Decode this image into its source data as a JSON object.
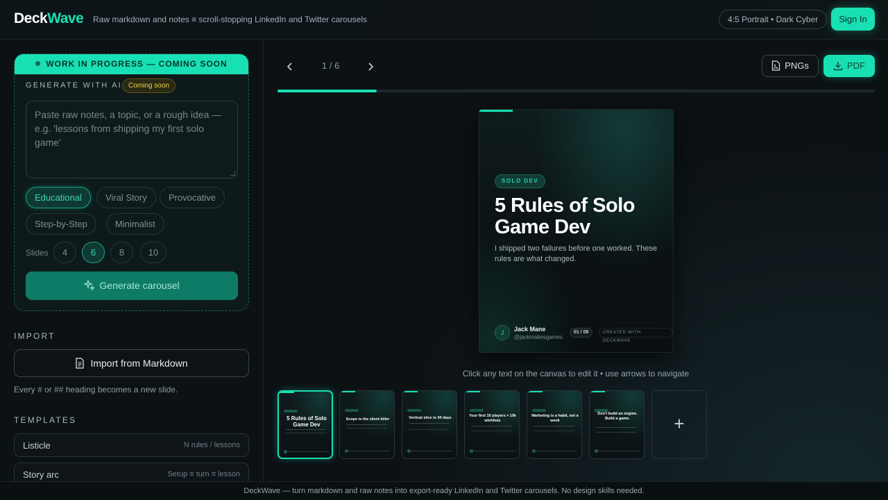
{
  "header": {
    "logo_prefix": "Deck",
    "logo_suffix": "Wave",
    "tagline": "Raw markdown and notes ≡ scroll-stopping LinkedIn and Twitter carousels",
    "format_label": "4:5 Portrait • Dark Cyber",
    "signin_label": "Sign In"
  },
  "sidebar": {
    "wip_banner": "WORK IN PROGRESS — COMING SOON",
    "generate_label": "GENERATE WITH AI",
    "coming_soon_badge": "Coming soon",
    "notes_placeholder": "Paste raw notes, a topic, or a rough idea — e.g. 'lessons from shipping my first solo game'",
    "styles": [
      {
        "label": "Educational",
        "active": true
      },
      {
        "label": "Viral Story",
        "active": false
      },
      {
        "label": "Provocative",
        "active": false
      },
      {
        "label": "Step-by-Step",
        "active": false
      },
      {
        "label": "Minimalist",
        "active": false
      }
    ],
    "slides_label": "Slides",
    "slide_counts": [
      "4",
      "6",
      "8",
      "10"
    ],
    "selected_slide_count": "6",
    "generate_button": "Generate carousel",
    "import_section": "IMPORT",
    "import_button": "Import from Markdown",
    "import_hint": "Every # or ## heading becomes a new slide.",
    "templates_section": "TEMPLATES",
    "templates": [
      {
        "name": "Listicle",
        "meta": "N rules / lessons"
      },
      {
        "name": "Story arc",
        "meta": "Setup ≡ turn ≡ lesson"
      }
    ]
  },
  "editor": {
    "page_indicator": "1 / 6",
    "progress": 0.1667,
    "png_button": "PNGs",
    "pdf_button": "PDF",
    "edit_hint": "Click any text on the canvas to edit it • use arrows to navigate"
  },
  "slide": {
    "tag": "SOLO DEV",
    "title": "5 Rules of Solo Game Dev",
    "subtitle": "I shipped two failures before one worked. These rules are what changed.",
    "avatar_initial": "J",
    "author": "Jack Mane",
    "handle": "@jackmakesgames",
    "counter": "01 / 08",
    "credit": "CREATED WITH DECKWAVE"
  },
  "thumbnails": [
    {
      "title": "5 Rules of Solo Game Dev",
      "active": true
    },
    {
      "title": "Scope is the silent killer",
      "active": false
    },
    {
      "title": "Vertical slice in 30 days",
      "active": false
    },
    {
      "title": "Your first 10 players > 10k wishlists",
      "active": false
    },
    {
      "title": "Marketing is a habit, not a week",
      "active": false
    },
    {
      "title": "Don't build an engine. Build a game.",
      "active": false
    }
  ],
  "add_slide_symbol": "+",
  "footer": {
    "text": "DeckWave — turn markdown and raw notes into export-ready LinkedIn and Twitter carousels. No design skills needed."
  },
  "colors": {
    "accent": "#19e0b4",
    "background": "#0b1013",
    "warning": "#f0cf4a"
  }
}
